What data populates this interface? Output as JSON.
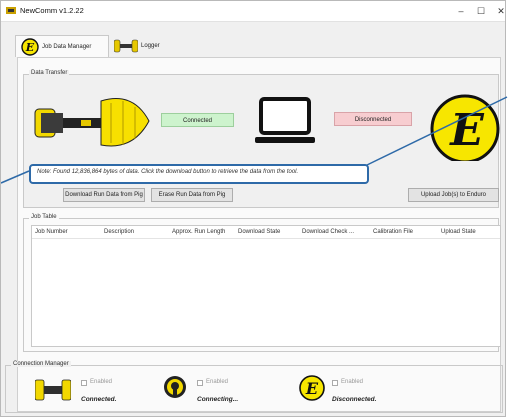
{
  "window": {
    "title": "NewComm v1.2.22",
    "minimize": "–",
    "maximize": "☐",
    "close": "✕"
  },
  "tabs": [
    {
      "label": "Job Data Manager",
      "active": true
    },
    {
      "label": "Logger",
      "active": false
    }
  ],
  "data_transfer": {
    "title": "Data Transfer",
    "left_status": "Connected",
    "right_status": "Disconnected",
    "note": "Note: Found 12,836,864 bytes of data. Click the download button to retrieve the data from the tool.",
    "buttons": {
      "download": "Download Run Data from Pig",
      "erase": "Erase Run Data from Pig",
      "upload": "Upload Job(s) to Enduro"
    }
  },
  "job_table": {
    "title": "Job Table",
    "columns": [
      "Job Number",
      "Description",
      "Approx. Run Length",
      "Download State",
      "Download Check ...",
      "Calibration File",
      "Upload State"
    ]
  },
  "connection_manager": {
    "title": "Connection Manager",
    "devices": [
      {
        "enabled_label": "Enabled",
        "status": "Connected."
      },
      {
        "enabled_label": "Enabled",
        "status": "Connecting..."
      },
      {
        "enabled_label": "Enabled",
        "status": "Disconnected."
      }
    ]
  },
  "colors": {
    "connected_bg": "#cdf3cd",
    "disconnected_bg": "#f7cdd0",
    "callout_border": "#2e6aa8",
    "logo_yellow": "#f7e600"
  },
  "icons": [
    "app-icon",
    "enduro-logo-icon",
    "pig-tool-icon",
    "laptop-icon",
    "beacon-icon"
  ]
}
